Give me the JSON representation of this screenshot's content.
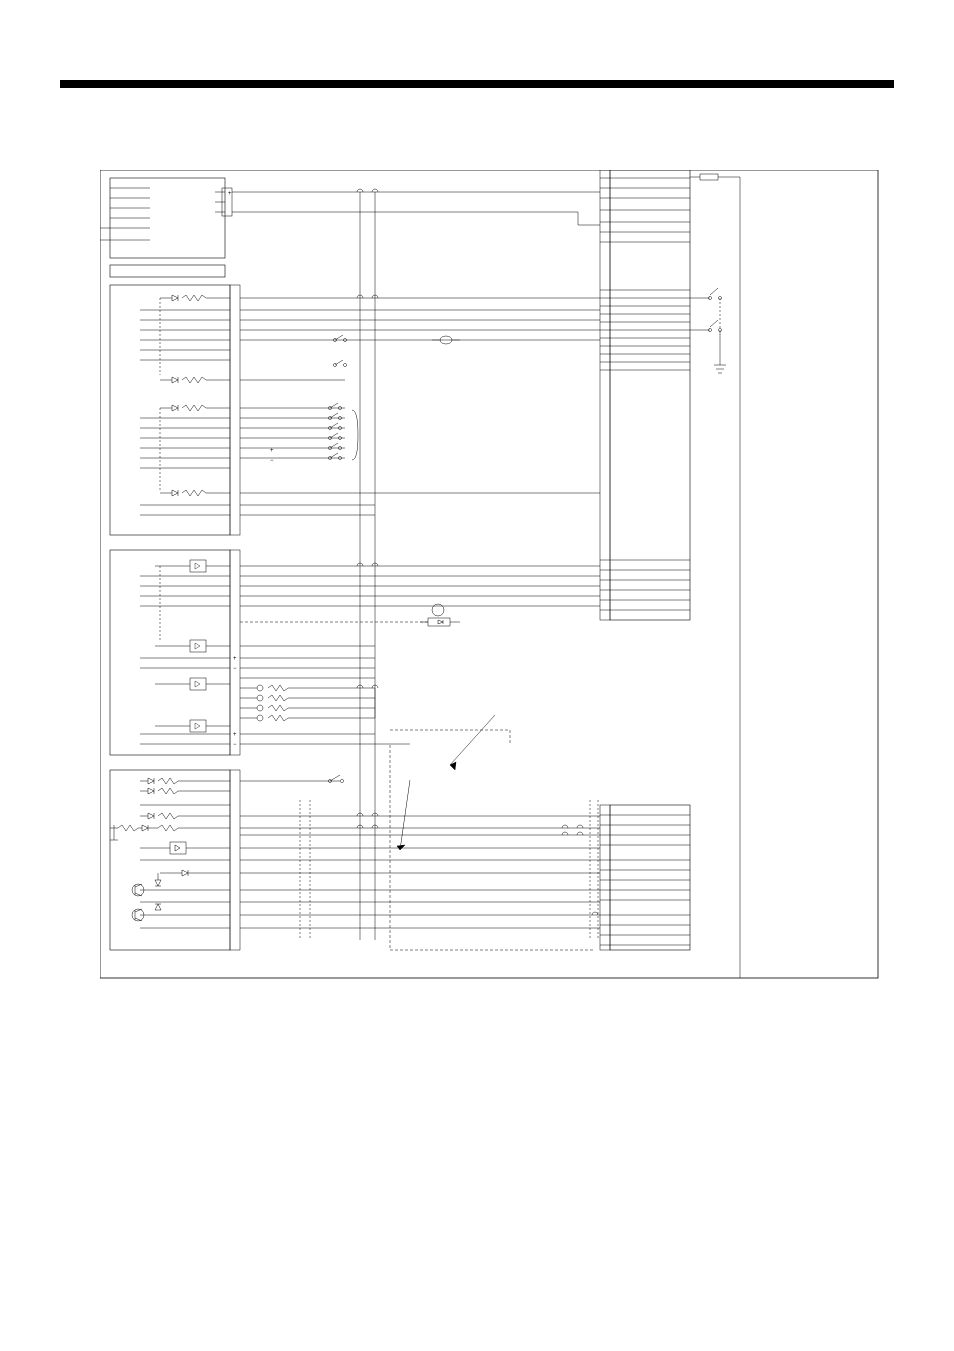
{
  "page_header": "",
  "block_a": {
    "title": "",
    "pins_left": [
      "",
      "",
      "",
      "",
      "",
      ""
    ],
    "pins_right": [
      "",
      "",
      ""
    ]
  },
  "separator_block": {
    "label": ""
  },
  "block_b": {
    "title": "",
    "pins_left": [
      "",
      "",
      "",
      "",
      "",
      "",
      "",
      "",
      "",
      "",
      "",
      "",
      "",
      "",
      "",
      "",
      "",
      "",
      "",
      ""
    ],
    "pins_right": [
      "",
      "",
      "",
      "",
      "",
      "",
      "",
      "",
      "",
      "",
      "",
      "",
      "",
      "",
      "",
      "",
      "",
      "",
      "",
      ""
    ],
    "plus": "+",
    "minus": "−"
  },
  "block_c": {
    "title": "",
    "pins_left": [
      "",
      "",
      "",
      "",
      "",
      "",
      "",
      "",
      "",
      "",
      "",
      "",
      "",
      "",
      "",
      "",
      ""
    ],
    "pins_right": [
      "",
      "",
      "",
      "",
      "",
      "",
      "",
      "",
      "",
      "",
      "",
      "",
      "",
      "",
      "",
      "",
      ""
    ],
    "plus1": "+",
    "minus1": "−",
    "plus2": "+",
    "minus2": "−"
  },
  "block_d": {
    "title": "",
    "pins_left": [
      "",
      "",
      "",
      "",
      "",
      "",
      "",
      "",
      "",
      "",
      "",
      ""
    ],
    "pins_right": [
      "",
      "",
      "",
      "",
      "",
      "",
      "",
      "",
      "",
      "",
      "",
      ""
    ]
  },
  "right_block_top": {
    "title": "",
    "pins": [
      "",
      "",
      "",
      "",
      "",
      "",
      "",
      "",
      "",
      "",
      "",
      "",
      "",
      "",
      "",
      "",
      "",
      "",
      "",
      "",
      "",
      "",
      "",
      "",
      "",
      "",
      "",
      "",
      "",
      "",
      "",
      "",
      "",
      "",
      "",
      "",
      "",
      "",
      "",
      "",
      ""
    ]
  },
  "right_block_bottom": {
    "title": "",
    "pins": [
      "",
      "",
      "",
      "",
      "",
      "",
      "",
      "",
      "",
      "",
      "",
      "",
      ""
    ]
  },
  "annotations": {
    "arrow1": "",
    "arrow2": ""
  }
}
